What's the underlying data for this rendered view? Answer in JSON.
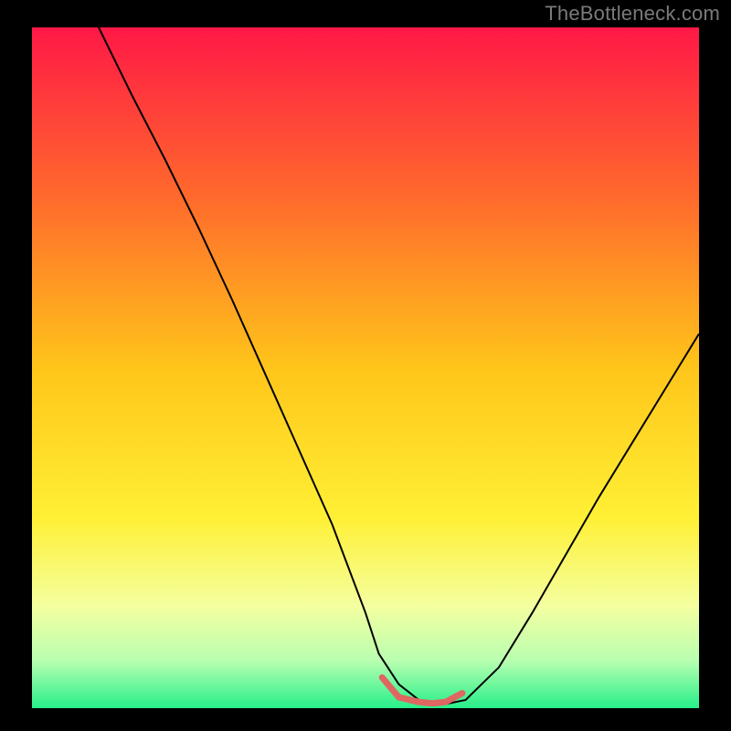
{
  "watermark": "TheBottleneck.com",
  "chart_data": {
    "type": "line",
    "title": "",
    "xlabel": "",
    "ylabel": "",
    "xlim": [
      0,
      100
    ],
    "ylim": [
      0,
      100
    ],
    "grid": false,
    "legend": false,
    "background_gradient": {
      "stops": [
        {
          "offset": 0.0,
          "color": "#ff1846"
        },
        {
          "offset": 0.25,
          "color": "#ff6a2c"
        },
        {
          "offset": 0.5,
          "color": "#ffc51a"
        },
        {
          "offset": 0.72,
          "color": "#fff035"
        },
        {
          "offset": 0.85,
          "color": "#f4ffa0"
        },
        {
          "offset": 0.93,
          "color": "#b9ffb0"
        },
        {
          "offset": 1.0,
          "color": "#27ef8a"
        }
      ]
    },
    "series": [
      {
        "name": "bottleneck-curve",
        "color": "#000000",
        "stroke_width": 2,
        "x": [
          10,
          15,
          20,
          25,
          30,
          35,
          40,
          45,
          50,
          52,
          55,
          58,
          60,
          62,
          65,
          70,
          75,
          80,
          85,
          90,
          95,
          100
        ],
        "y": [
          100,
          90,
          80.5,
          70.5,
          60,
          49,
          38,
          27,
          14,
          8,
          3.5,
          1.2,
          0.6,
          0.6,
          1.2,
          6,
          14,
          22.5,
          31,
          39,
          47,
          55
        ]
      },
      {
        "name": "optimal-marker",
        "color": "#e06662",
        "stroke_width": 7,
        "linecap": "round",
        "x": [
          52.5,
          55,
          58,
          60,
          62,
          64.5
        ],
        "y": [
          4.5,
          1.6,
          0.9,
          0.7,
          0.9,
          2.2
        ]
      }
    ]
  }
}
